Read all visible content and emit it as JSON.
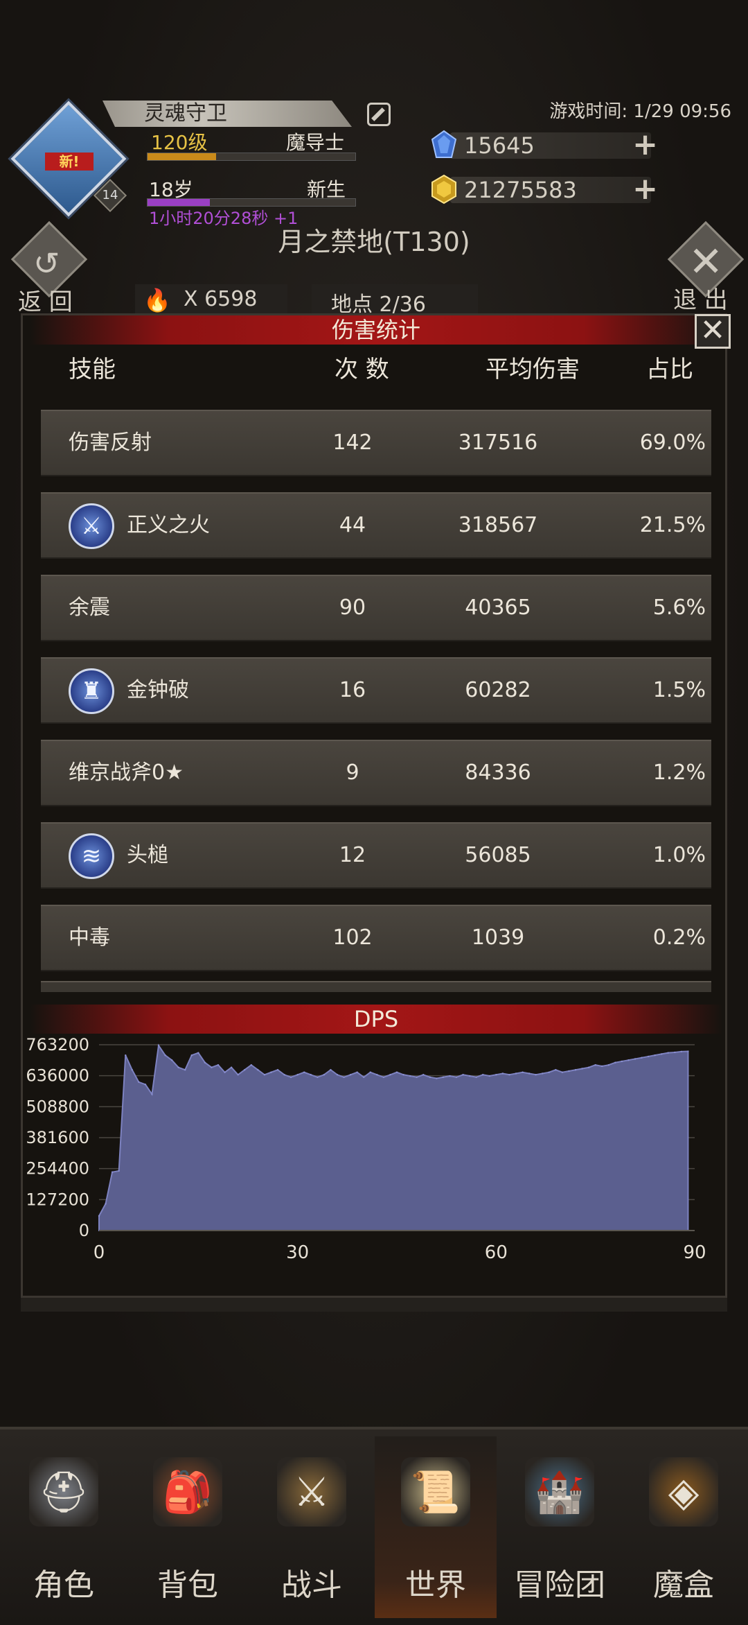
{
  "header": {
    "avatar_badge": "新!",
    "avatar_level": "14",
    "player_name": "灵魂守卫",
    "level_text": "120级",
    "class_name": "魔导士",
    "age_text": "18岁",
    "stage_text": "新生",
    "timer_text": "1小时20分28秒 +1",
    "game_time": "游戏时间: 1/29 09:56",
    "gems": "15645",
    "gold": "21275583",
    "level_progress": 0.33,
    "age_progress": 0.3
  },
  "map": {
    "title": "月之禁地(T130)",
    "back_label": "返 回",
    "exit_label": "退 出",
    "torch_count": "X 6598",
    "location": "地点 2/36"
  },
  "damage_panel": {
    "title": "伤害统计",
    "close": "✕",
    "columns": {
      "skill": "技能",
      "count": "次 数",
      "avg": "平均伤害",
      "pct": "占比"
    },
    "rows": [
      {
        "name": "伤害反射",
        "count": "142",
        "avg": "317516",
        "pct": "69.0%",
        "icon": ""
      },
      {
        "name": "正义之火",
        "count": "44",
        "avg": "318567",
        "pct": "21.5%",
        "icon": "sword-icon"
      },
      {
        "name": "余震",
        "count": "90",
        "avg": "40365",
        "pct": "5.6%",
        "icon": ""
      },
      {
        "name": "金钟破",
        "count": "16",
        "avg": "60282",
        "pct": "1.5%",
        "icon": "bell-knight-icon"
      },
      {
        "name": "维京战斧0★",
        "count": "9",
        "avg": "84336",
        "pct": "1.2%",
        "icon": ""
      },
      {
        "name": "头槌",
        "count": "12",
        "avg": "56085",
        "pct": "1.0%",
        "icon": "claw-icon"
      },
      {
        "name": "中毒",
        "count": "102",
        "avg": "1039",
        "pct": "0.2%",
        "icon": ""
      }
    ]
  },
  "chart_data": {
    "type": "area",
    "title": "DPS",
    "xlabel": "",
    "ylabel": "",
    "xlim": [
      0,
      90
    ],
    "ylim": [
      0,
      763200
    ],
    "x_ticks": [
      0,
      30,
      60,
      90
    ],
    "y_ticks": [
      0,
      127200,
      254400,
      381600,
      508800,
      636000,
      763200
    ],
    "grid": true,
    "color": "#5b5f8f",
    "x": [
      0,
      1,
      2,
      3,
      4,
      5,
      6,
      7,
      8,
      9,
      10,
      11,
      12,
      13,
      14,
      15,
      16,
      17,
      18,
      19,
      20,
      21,
      22,
      23,
      24,
      25,
      26,
      27,
      28,
      29,
      30,
      31,
      32,
      33,
      34,
      35,
      36,
      37,
      38,
      39,
      40,
      41,
      42,
      43,
      44,
      45,
      46,
      47,
      48,
      49,
      50,
      51,
      52,
      53,
      54,
      55,
      56,
      57,
      58,
      59,
      60,
      61,
      62,
      63,
      64,
      65,
      66,
      67,
      68,
      69,
      70,
      71,
      72,
      73,
      74,
      75,
      76,
      77,
      78,
      79,
      80,
      81,
      82,
      83,
      84,
      85,
      86,
      87,
      88,
      89
    ],
    "y": [
      60000,
      110000,
      240000,
      245000,
      720000,
      660000,
      610000,
      600000,
      560000,
      760000,
      720000,
      700000,
      670000,
      660000,
      720000,
      730000,
      690000,
      670000,
      680000,
      650000,
      670000,
      640000,
      660000,
      680000,
      660000,
      640000,
      650000,
      660000,
      640000,
      630000,
      640000,
      650000,
      640000,
      630000,
      640000,
      660000,
      640000,
      630000,
      640000,
      650000,
      630000,
      650000,
      640000,
      630000,
      640000,
      650000,
      640000,
      635000,
      630000,
      640000,
      630000,
      625000,
      630000,
      635000,
      630000,
      640000,
      635000,
      630000,
      640000,
      635000,
      640000,
      645000,
      640000,
      645000,
      650000,
      645000,
      640000,
      645000,
      650000,
      660000,
      650000,
      655000,
      660000,
      665000,
      670000,
      680000,
      675000,
      680000,
      690000,
      695000,
      700000,
      705000,
      710000,
      715000,
      720000,
      725000,
      730000,
      732000,
      735000,
      736000
    ]
  },
  "nav": [
    {
      "label": "角色",
      "icon": "helmet-icon"
    },
    {
      "label": "背包",
      "icon": "backpack-icon"
    },
    {
      "label": "战斗",
      "icon": "shield-sword-icon"
    },
    {
      "label": "世界",
      "icon": "scroll-icon",
      "active": true
    },
    {
      "label": "冒险团",
      "icon": "castle-icon"
    },
    {
      "label": "魔盒",
      "icon": "magic-box-icon"
    }
  ],
  "colors": {
    "banner_red": "#a31616",
    "level_gold": "#e6c245",
    "timer_purple": "#b14fd6",
    "dps_fill": "#5b5f8f"
  }
}
